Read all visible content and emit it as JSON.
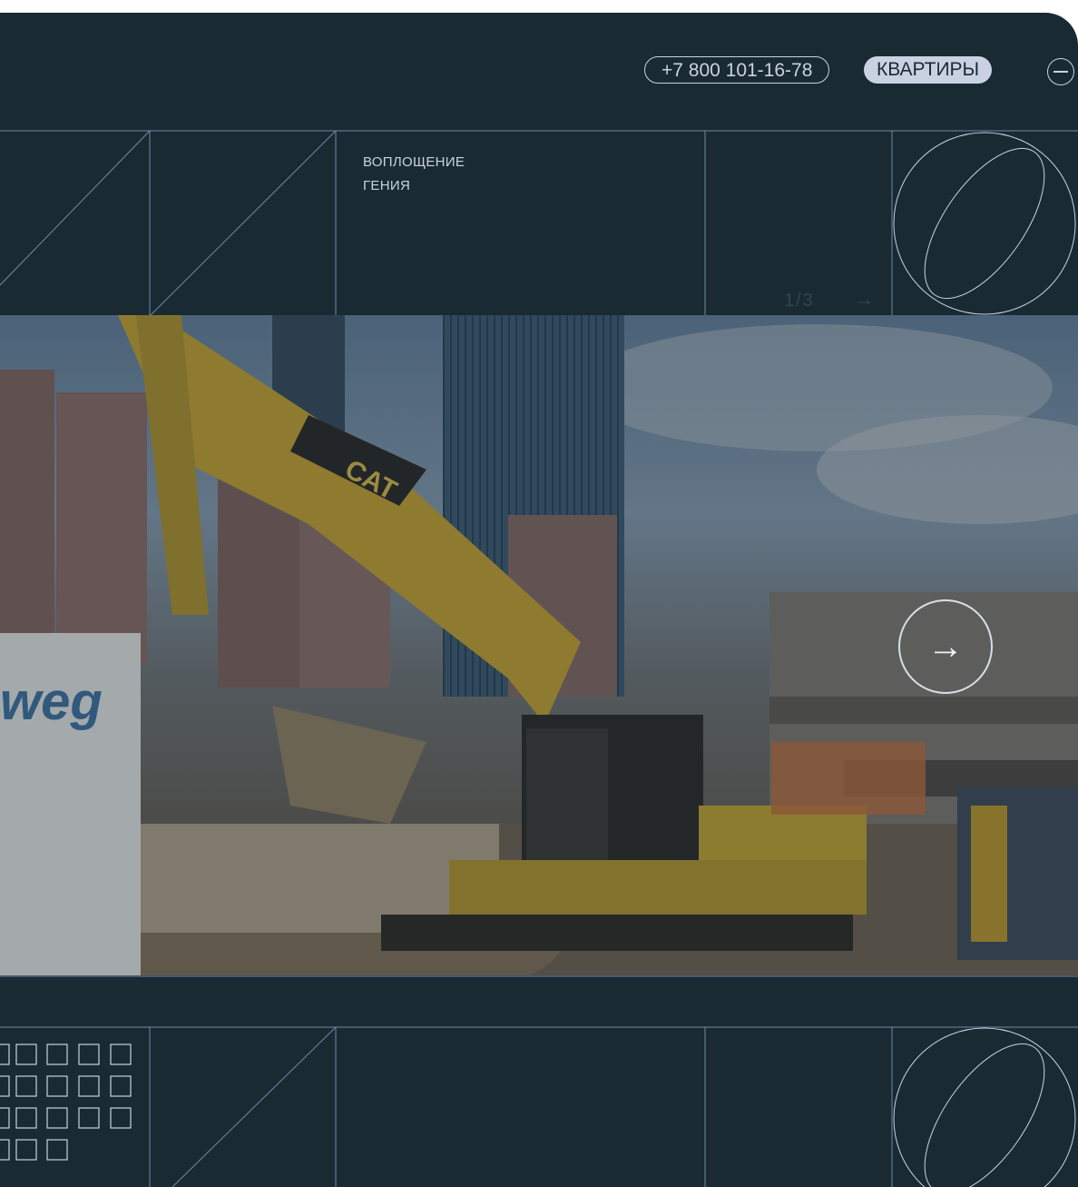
{
  "header": {
    "phone": "+7 800 101-16-78",
    "apartments_label": "КВАРТИРЫ",
    "menu_icon": "menu-circle-icon"
  },
  "hero": {
    "tagline_line1": "ВОПЛОЩЕНИЕ",
    "tagline_line2": "ГЕНИЯ",
    "slide_counter": "1/3",
    "next_arrow": "→",
    "photo_logo_text": "weg",
    "photo_cat_text": "CAT"
  },
  "colors": {
    "background": "#1a2a33",
    "line": "#c9d2e2",
    "accent_pill": "#c9d2e2"
  }
}
